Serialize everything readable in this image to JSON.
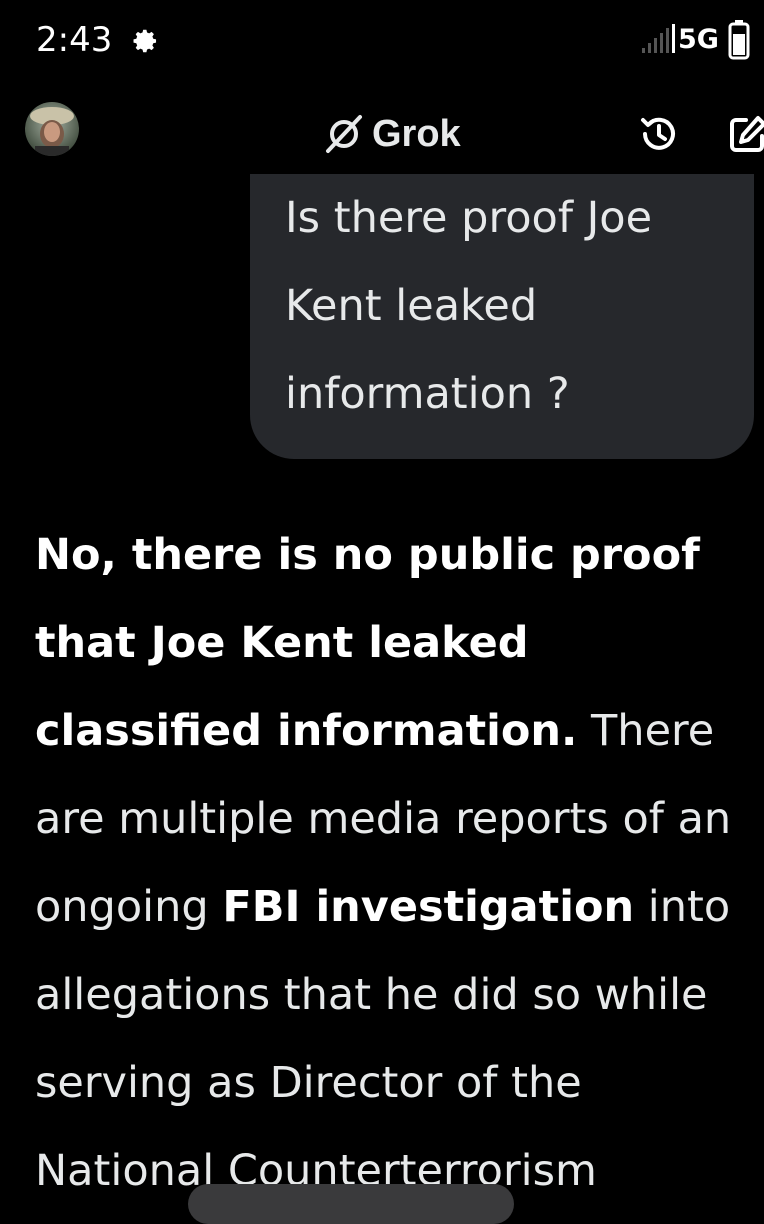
{
  "status_bar": {
    "time": "2:43",
    "network": "5G"
  },
  "header": {
    "title": "Grok"
  },
  "user_message": {
    "lines": [
      "Is there proof Joe",
      "Kent leaked",
      "information ?"
    ]
  },
  "response": {
    "bold_1": "No, there is no public proof that Joe Kent leaked classified information.",
    "text_1": " There are multiple media reports of an ongoing ",
    "bold_2": "FBI investigation",
    "text_2": " into allegations that he did so while serving as Director of the National Counterterrorism"
  },
  "colors": {
    "background": "#000000",
    "bubble": "#26282c",
    "text": "#e7e9ea"
  }
}
